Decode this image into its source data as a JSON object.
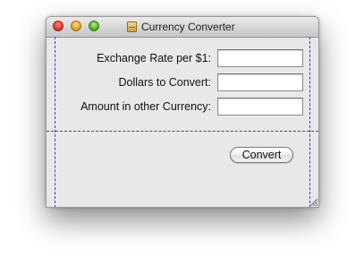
{
  "window": {
    "title": "Currency Converter",
    "title_icon": "document-icon"
  },
  "form": {
    "rate_label": "Exchange Rate per $1:",
    "rate_value": "",
    "dollars_label": "Dollars to Convert:",
    "dollars_value": "",
    "amount_label": "Amount in other Currency:",
    "amount_value": ""
  },
  "buttons": {
    "convert_label": "Convert"
  },
  "colors": {
    "guide": "#3a3ad8",
    "close": "#d52e1f",
    "minimize": "#d99a10",
    "zoom": "#4aa31c"
  }
}
